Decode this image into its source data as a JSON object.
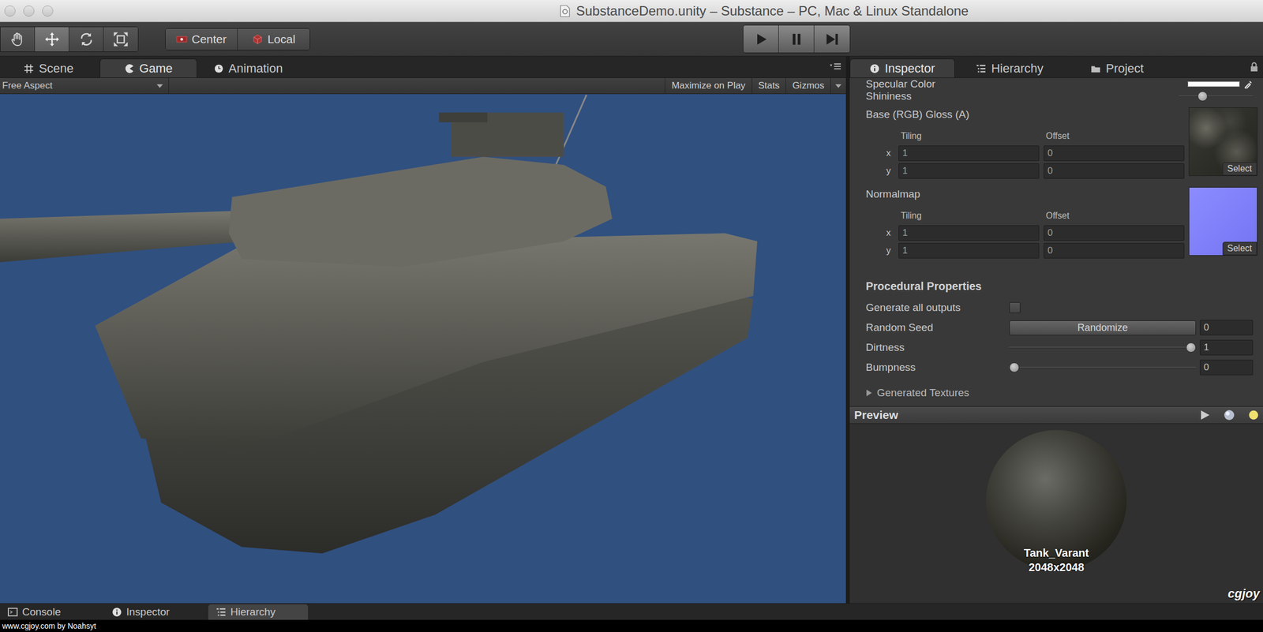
{
  "window": {
    "title": "SubstanceDemo.unity – Substance – PC, Mac & Linux Standalone"
  },
  "toolbar": {
    "tools": [
      {
        "kind": "hand",
        "selected": false
      },
      {
        "kind": "move",
        "selected": true
      },
      {
        "kind": "rotate",
        "selected": false
      },
      {
        "kind": "scale",
        "selected": false
      }
    ],
    "pivot": [
      {
        "kind": "center",
        "label": "Center"
      },
      {
        "kind": "local",
        "label": "Local"
      }
    ],
    "playback": [
      {
        "kind": "play",
        "selected": false
      },
      {
        "kind": "pause",
        "selected": false
      },
      {
        "kind": "step",
        "selected": false
      }
    ]
  },
  "view_tabs": [
    {
      "label": "Scene",
      "kind": "scene",
      "selected": false
    },
    {
      "label": "Game",
      "kind": "game",
      "selected": true
    },
    {
      "label": "Animation",
      "kind": "animation",
      "selected": false
    }
  ],
  "game_bar": {
    "aspect": "Free Aspect",
    "buttons": [
      "Maximize on Play",
      "Stats",
      "Gizmos"
    ]
  },
  "panel_tabs": [
    {
      "label": "Inspector",
      "kind": "inspector",
      "selected": true
    },
    {
      "label": "Hierarchy",
      "kind": "hierarchy",
      "selected": false
    },
    {
      "label": "Project",
      "kind": "project",
      "selected": false
    }
  ],
  "inspector": {
    "specular": {
      "label": "Specular Color"
    },
    "shininess": {
      "label": "Shininess",
      "level": 0.29
    },
    "textures": [
      {
        "label": "Base (RGB) Gloss (A)",
        "kind": "diffuse",
        "tiling_label": "Tiling",
        "offset_label": "Offset",
        "rows": [
          {
            "axis": "x",
            "tiling": "1",
            "offset": "0"
          },
          {
            "axis": "y",
            "tiling": "1",
            "offset": "0"
          }
        ],
        "button": "Select"
      },
      {
        "label": "Normalmap",
        "kind": "normal",
        "tiling_label": "Tiling",
        "offset_label": "Offset",
        "rows": [
          {
            "axis": "x",
            "tiling": "1",
            "offset": "0"
          },
          {
            "axis": "y",
            "tiling": "1",
            "offset": "0"
          }
        ],
        "button": "Select"
      }
    ],
    "procedural": {
      "title": "Procedural Properties",
      "items": [
        {
          "kind": "checkbox",
          "label": "Generate all outputs",
          "checked": false
        },
        {
          "kind": "button",
          "label": "Random Seed",
          "button": "Randomize",
          "value": "0"
        },
        {
          "kind": "slider",
          "label": "Dirtness",
          "level": 1,
          "value": "1"
        },
        {
          "kind": "slider",
          "label": "Bumpness",
          "level": 0,
          "value": "0"
        }
      ]
    },
    "foldout": {
      "label": "Generated Textures",
      "expanded": false
    }
  },
  "preview": {
    "title": "Preview",
    "name": "Tank_Varant",
    "size": "2048x2048"
  },
  "bottom_tabs": [
    {
      "label": "Console",
      "kind": "console",
      "selected": false
    },
    {
      "label": "Inspector",
      "kind": "inspector",
      "selected": false
    },
    {
      "label": "Hierarchy",
      "kind": "hierarchy",
      "selected": true
    }
  ],
  "footer": "www.cgjoy.com by Noahsyt",
  "watermark": "cgjoy"
}
